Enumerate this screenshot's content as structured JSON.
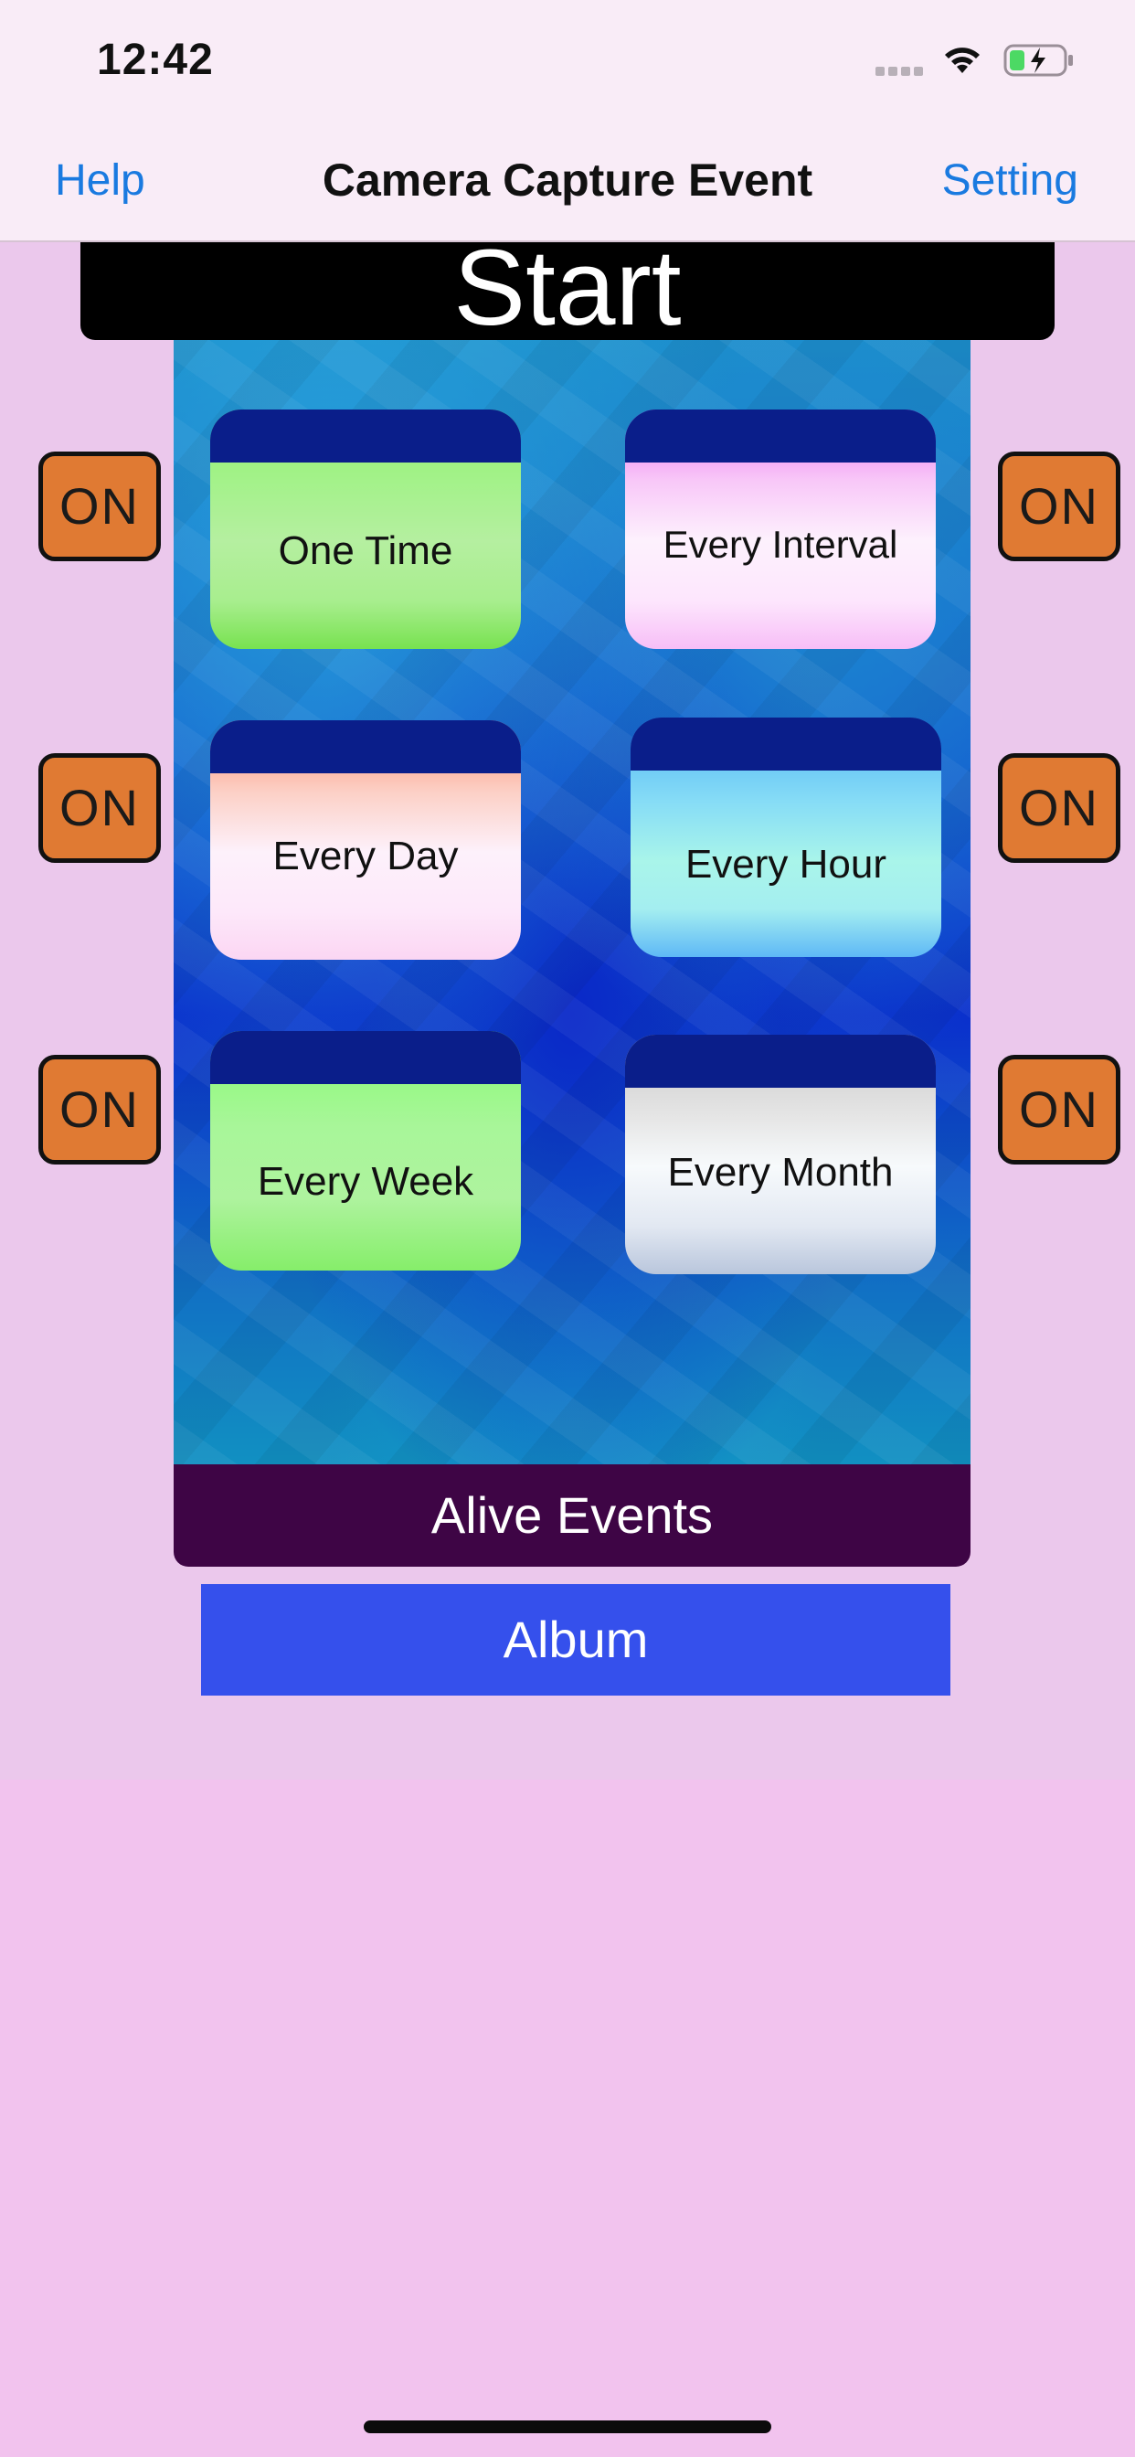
{
  "status_bar": {
    "time": "12:42"
  },
  "nav": {
    "left_button": "Help",
    "title": "Camera Capture Event",
    "right_button": "Setting"
  },
  "start_button": "Start",
  "events": {
    "one_time": "One Time",
    "every_interval": "Every Interval",
    "every_day": "Every Day",
    "every_hour": "Every Hour",
    "every_week": "Every Week",
    "every_month": "Every Month"
  },
  "toggles": {
    "left_1": "ON",
    "right_1": "ON",
    "left_2": "ON",
    "right_2": "ON",
    "left_3": "ON",
    "right_3": "ON"
  },
  "alive_events_button": "Alive Events",
  "album_button": "Album",
  "icons": {
    "signal": "signal-icon",
    "wifi": "wifi-icon",
    "battery": "battery-charging-icon"
  },
  "colors": {
    "link": "#1a7ae0",
    "toggle": "#e07a33",
    "alive_events_bg": "#3e0545",
    "album_bg": "#3550ec"
  }
}
